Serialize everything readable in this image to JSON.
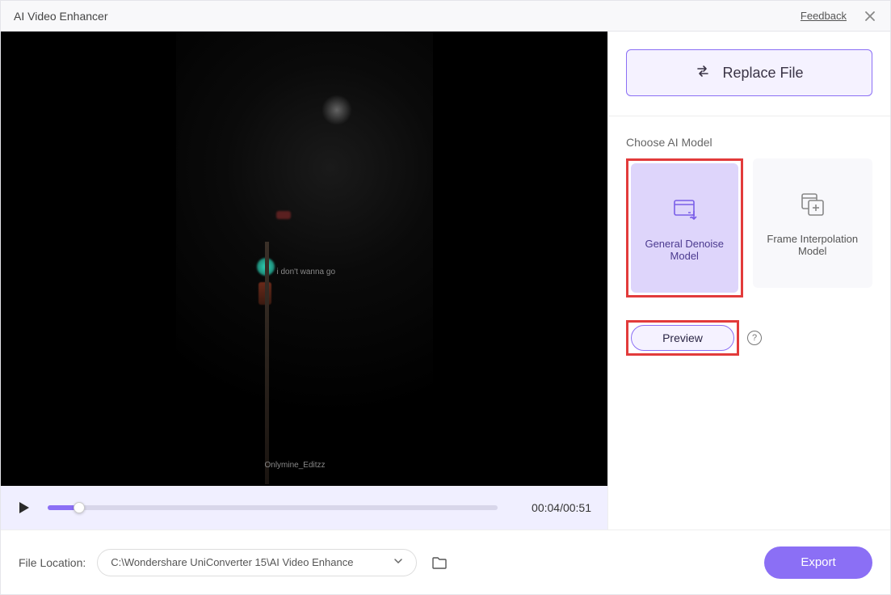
{
  "title": "AI Video Enhancer",
  "header": {
    "feedback_label": "Feedback"
  },
  "video": {
    "subtitle_line": "i don't wanna go",
    "watermark": "Onlymine_Editzz"
  },
  "player": {
    "current_time": "00:04",
    "duration": "00:51",
    "time_display": "00:04/00:51",
    "progress_percent": 7
  },
  "sidebar": {
    "replace_file_label": "Replace File",
    "choose_model_label": "Choose AI Model",
    "models": [
      {
        "name": "General Denoise Model",
        "selected": true
      },
      {
        "name": "Frame Interpolation Model",
        "selected": false
      }
    ],
    "preview_label": "Preview",
    "help_glyph": "?"
  },
  "footer": {
    "location_label": "File Location:",
    "location_path": "C:\\Wondershare UniConverter 15\\AI Video Enhance",
    "export_label": "Export"
  },
  "colors": {
    "accent": "#8b6ff5",
    "highlight": "#e23b3b"
  }
}
